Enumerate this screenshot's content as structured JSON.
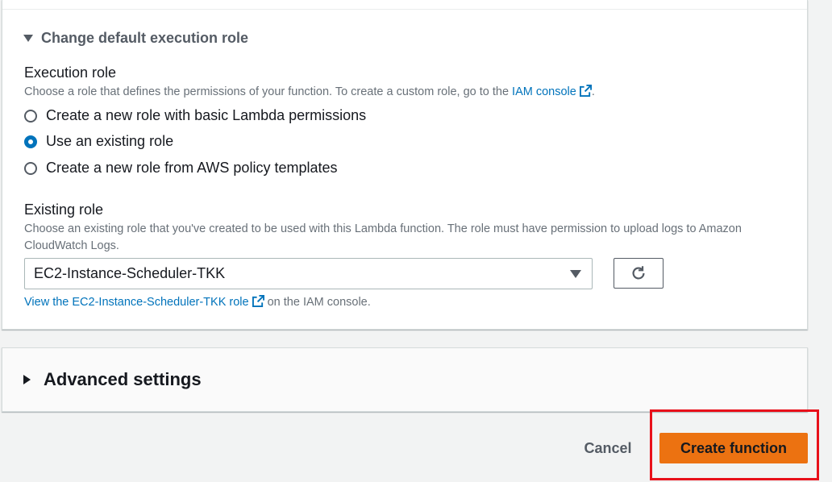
{
  "execution_role_section": {
    "toggle_label": "Change default execution role",
    "title": "Execution role",
    "description_prefix": "Choose a role that defines the permissions of your function. To create a custom role, go to the ",
    "description_link": "IAM console",
    "description_suffix": ".",
    "options": [
      {
        "label": "Create a new role with basic Lambda permissions",
        "checked": false
      },
      {
        "label": "Use an existing role",
        "checked": true
      },
      {
        "label": "Create a new role from AWS policy templates",
        "checked": false
      }
    ]
  },
  "existing_role": {
    "title": "Existing role",
    "description": "Choose an existing role that you've created to be used with this Lambda function. The role must have permission to upload logs to Amazon CloudWatch Logs.",
    "selected_value": "EC2-Instance-Scheduler-TKK",
    "view_link": "View the EC2-Instance-Scheduler-TKK role",
    "view_suffix": " on the IAM console."
  },
  "advanced_settings": {
    "label": "Advanced settings"
  },
  "actions": {
    "cancel_label": "Cancel",
    "create_label": "Create function"
  },
  "colors": {
    "accent": "#0073bb",
    "primary_button": "#ec7211",
    "highlight": "#e8101a"
  }
}
